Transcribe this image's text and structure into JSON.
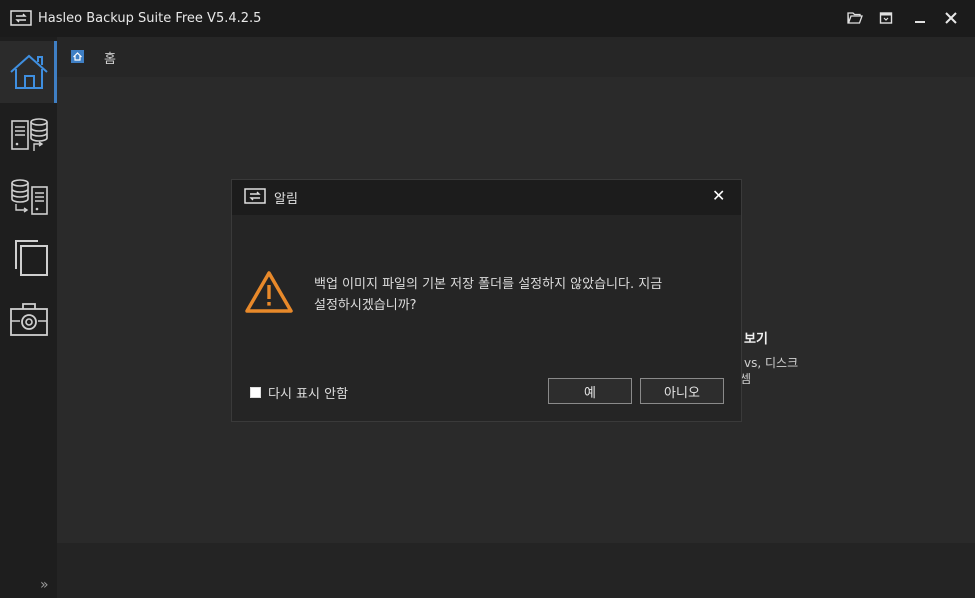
{
  "window": {
    "title": "Hasleo Backup Suite Free V5.4.2.5"
  },
  "titlebar_buttons": [
    "folder-open-icon",
    "restore-icon",
    "minimize-icon",
    "close-icon"
  ],
  "sidebar": {
    "items": [
      {
        "icon": "home-icon",
        "active": true
      },
      {
        "icon": "backup-icon",
        "active": false
      },
      {
        "icon": "restore-backup-icon",
        "active": false
      },
      {
        "icon": "clone-icon",
        "active": false
      },
      {
        "icon": "tools-icon",
        "active": false
      }
    ],
    "expand_icon": "»"
  },
  "breadcrumb": {
    "label": "홈"
  },
  "background_panel": {
    "title_fragment": "보기",
    "desc_line1": "vs, 디스크",
    "desc_line2": "셈"
  },
  "dialog": {
    "title": "알림",
    "close_glyph": "✕",
    "message_line1": "백업 이미지 파일의 기본 저장 폴더를 설정하지 않았습니다. 지금",
    "message_line2": "설정하시겠습니까?",
    "checkbox_label": "다시 표시 안함",
    "yes_label": "예",
    "no_label": "아니오"
  },
  "colors": {
    "accent": "#3f7fc4",
    "warning": "#e8892a",
    "titlebar": "#1b1b1b",
    "background": "#2a2a2a"
  }
}
